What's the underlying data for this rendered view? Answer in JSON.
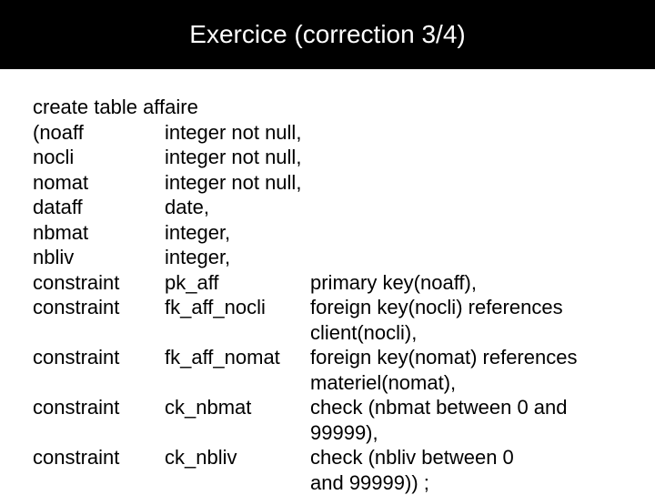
{
  "title": "Exercice (correction 3/4)",
  "header": "create table affaire",
  "rows": [
    {
      "c1": "(noaff",
      "c2": "integer not null,",
      "c3": ""
    },
    {
      "c1": "nocli",
      "c2": "integer not null,",
      "c3": ""
    },
    {
      "c1": "nomat",
      "c2": "integer not null,",
      "c3": ""
    },
    {
      "c1": "dataff",
      "c2": "date,",
      "c3": ""
    },
    {
      "c1": "nbmat",
      "c2": "integer,",
      "c3": ""
    },
    {
      "c1": "nbliv",
      "c2": "integer,",
      "c3": ""
    },
    {
      "c1": "constraint",
      "c2": "pk_aff",
      "c3": "primary key(noaff),"
    },
    {
      "c1": "constraint",
      "c2": "fk_aff_nocli",
      "c3": "foreign key(nocli) references"
    },
    {
      "c1": "",
      "c2": "",
      "c3": "client(nocli),"
    },
    {
      "c1": "constraint",
      "c2": "fk_aff_nomat",
      "c3": "foreign key(nomat) references"
    },
    {
      "c1": "",
      "c2": "",
      "c3": "materiel(nomat),"
    },
    {
      "c1": "constraint",
      "c2": "ck_nbmat",
      "c3": "check (nbmat between 0 and"
    },
    {
      "c1": "",
      "c2": "",
      "c3": "99999),"
    },
    {
      "c1": "constraint",
      "c2": "ck_nbliv",
      "c3": "check (nbliv between 0"
    },
    {
      "c1": "",
      "c2": "",
      "c3": "and 99999)) ;"
    }
  ]
}
